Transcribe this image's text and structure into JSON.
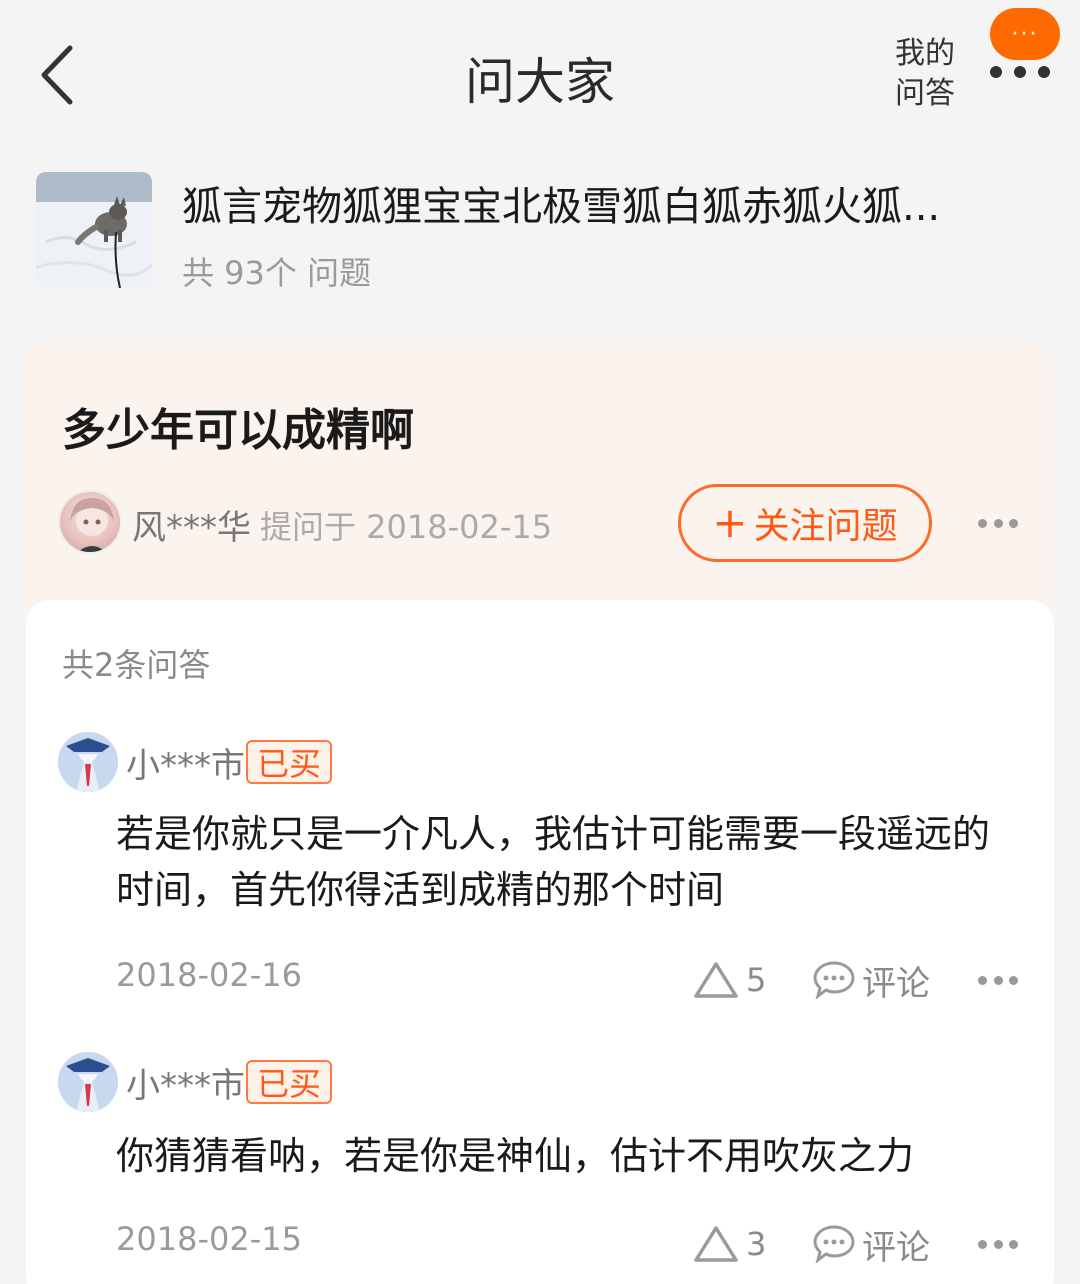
{
  "header": {
    "title": "问大家",
    "my_qa_line1": "我的",
    "my_qa_line2": "问答",
    "badge_dots": "···"
  },
  "product": {
    "name": "狐言宠物狐狸宝宝北极雪狐白狐赤狐火狐...",
    "question_count": "共 93个 问题"
  },
  "question": {
    "title": "多少年可以成精啊",
    "asker_name": "风***华",
    "asked_meta": "提问于 2018-02-15",
    "follow_plus": "+",
    "follow_label": "关注问题"
  },
  "answers_section": {
    "count_label": "共2条问答",
    "answers": [
      {
        "user": "小***市",
        "badge": "已买",
        "text": "若是你就只是一介凡人，我估计可能需要一段遥远的时间，首先你得活到成精的那个时间",
        "date": "2018-02-16",
        "likes": "5",
        "comment_label": "评论"
      },
      {
        "user": "小***市",
        "badge": "已买",
        "text": "你猜猜看呐，若是你是神仙，估计不用吹灰之力",
        "date": "2018-02-15",
        "likes": "3",
        "comment_label": "评论"
      }
    ]
  },
  "colors": {
    "accent": "#ff5a14",
    "badge_bg": "#ff6a00",
    "question_card_bg": "#fbf3ed",
    "page_bg": "#f4f4f4"
  },
  "icons": {
    "back": "chevron-left-icon",
    "more": "more-dots-icon",
    "like": "triangle-like-icon",
    "comment": "speech-bubble-icon"
  }
}
